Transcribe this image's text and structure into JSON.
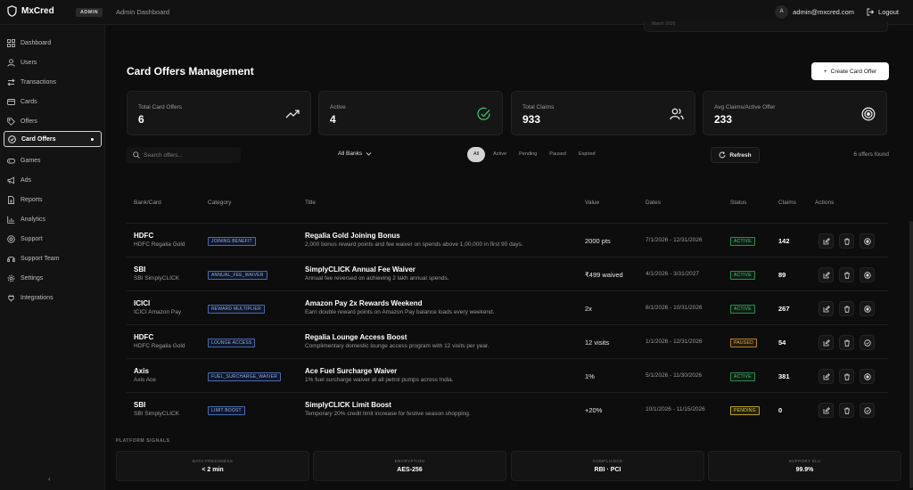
{
  "app": {
    "name": "MxCred",
    "badge": "ADMIN",
    "section_title": "Admin Dashboard"
  },
  "user": {
    "avatar_initial": "A",
    "email": "admin@mxcred.com",
    "logout_label": "Logout"
  },
  "sidebar": {
    "items": [
      {
        "label": "Dashboard",
        "icon": "grid-icon"
      },
      {
        "label": "Users",
        "icon": "user-icon"
      },
      {
        "label": "Transactions",
        "icon": "swap-icon"
      },
      {
        "label": "Cards",
        "icon": "card-icon"
      },
      {
        "label": "Offers",
        "icon": "tag-icon"
      },
      {
        "label": "Card Offers",
        "icon": "badge-icon",
        "active": true
      },
      {
        "label": "Games",
        "icon": "gamepad-icon"
      },
      {
        "label": "Ads",
        "icon": "megaphone-icon"
      },
      {
        "label": "Reports",
        "icon": "document-icon"
      },
      {
        "label": "Analytics",
        "icon": "chart-icon"
      },
      {
        "label": "Support",
        "icon": "help-icon"
      },
      {
        "label": "Support Team",
        "icon": "headset-icon"
      },
      {
        "label": "Settings",
        "icon": "gear-icon"
      },
      {
        "label": "Integrations",
        "icon": "plug-icon"
      }
    ],
    "collapse_label": "‹"
  },
  "ghost_card_text": "March 2026",
  "page": {
    "title": "Card Offers Management",
    "create_label": "Create Card Offer"
  },
  "stats": [
    {
      "label": "Total Card Offers",
      "value": "6",
      "icon": "trending-up-icon"
    },
    {
      "label": "Active",
      "value": "4",
      "icon": "check-circle-icon",
      "color": "#3fbf6a"
    },
    {
      "label": "Total Claims",
      "value": "933",
      "icon": "users-icon"
    },
    {
      "label": "Avg Claims/Active Offer",
      "value": "233",
      "icon": "target-icon"
    }
  ],
  "toolbar": {
    "search_placeholder": "Search offers...",
    "bank_filter": "All Banks",
    "filters": [
      "All",
      "Active",
      "Pending",
      "Paused",
      "Expired"
    ],
    "active_filter": "All",
    "refresh_label": "Refresh",
    "found_text": "6 offers found"
  },
  "table": {
    "columns": [
      "Bank/Card",
      "Category",
      "Title",
      "Value",
      "Dates",
      "Status",
      "Claims",
      "Actions"
    ],
    "rows": [
      {
        "bank": "HDFC",
        "card": "HDFC Regalia Gold",
        "category": "JOINING BENEFIT",
        "title": "Regalia Gold Joining Bonus",
        "desc": "2,000 bonus reward points and fee waiver on spends above 1,00,000 in first 90 days.",
        "value": "2000 pts",
        "dates": "7/1/2026 - 12/31/2026",
        "status": "ACTIVE",
        "status_type": "active",
        "claims": "142"
      },
      {
        "bank": "SBI",
        "card": "SBI SimplyCLICK",
        "category": "ANNUAL_FEE_WAIVER",
        "title": "SimplyCLICK Annual Fee Waiver",
        "desc": "Annual fee reversed on achieving 2 lakh annual spends.",
        "value": "₹499 waived",
        "dates": "4/1/2026 - 3/31/2027",
        "status": "ACTIVE",
        "status_type": "active",
        "claims": "89"
      },
      {
        "bank": "ICICI",
        "card": "ICICI Amazon Pay",
        "category": "REWARD MULTIPLIER",
        "title": "Amazon Pay 2x Rewards Weekend",
        "desc": "Earn double reward points on Amazon Pay balance loads every weekend.",
        "value": "2x",
        "dates": "8/1/2026 - 10/31/2026",
        "status": "ACTIVE",
        "status_type": "active",
        "claims": "267"
      },
      {
        "bank": "HDFC",
        "card": "HDFC Regalia Gold",
        "category": "LOUNGE ACCESS",
        "title": "Regalia Lounge Access Boost",
        "desc": "Complimentary domestic lounge access program with 12 visits per year.",
        "value": "12 visits",
        "dates": "1/1/2026 - 12/31/2026",
        "status": "PAUSED",
        "status_type": "paused",
        "claims": "54"
      },
      {
        "bank": "Axis",
        "card": "Axis Ace",
        "category": "FUEL_SURCHARGE_WAIVER",
        "title": "Ace Fuel Surcharge Waiver",
        "desc": "1% fuel surcharge waiver at all petrol pumps across India.",
        "value": "1%",
        "dates": "5/1/2026 - 11/30/2026",
        "status": "ACTIVE",
        "status_type": "active",
        "claims": "381"
      },
      {
        "bank": "SBI",
        "card": "SBI SimplyCLICK",
        "category": "LIMIT BOOST",
        "title": "SimplyCLICK Limit Boost",
        "desc": "Temporary 20% credit limit increase for festive season shopping.",
        "value": "+20%",
        "dates": "10/1/2026 - 11/15/2026",
        "status": "PENDING",
        "status_type": "pending",
        "claims": "0"
      }
    ]
  },
  "signals": {
    "title": "PLATFORM SIGNALS",
    "items": [
      {
        "label": "DATA FRESHNESS",
        "value": "< 2 min"
      },
      {
        "label": "ENCRYPTION",
        "value": "AES-256"
      },
      {
        "label": "COMPLIANCE",
        "value": "RBI · PCI"
      },
      {
        "label": "SUPPORT SLA",
        "value": "99.9%"
      }
    ]
  }
}
